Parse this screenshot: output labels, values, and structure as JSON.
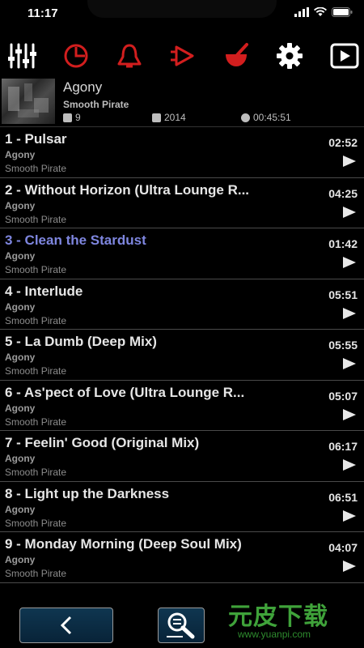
{
  "status": {
    "time": "11:17"
  },
  "toolbar": {
    "buttons": [
      {
        "name": "equalizer-icon",
        "color": "#ffffff"
      },
      {
        "name": "timer-icon",
        "color": "#d21e1e"
      },
      {
        "name": "bell-icon",
        "color": "#d21e1e"
      },
      {
        "name": "amplifier-icon",
        "color": "#d21e1e"
      },
      {
        "name": "mortar-icon",
        "color": "#d21e1e"
      },
      {
        "name": "gear-icon",
        "color": "#ffffff"
      },
      {
        "name": "play-box-icon",
        "color": "#ffffff"
      }
    ]
  },
  "album": {
    "title": "Agony",
    "artist": "Smooth Pirate",
    "track_count": "9",
    "year": "2014",
    "total_time": "00:45:51"
  },
  "tracks": [
    {
      "title": "1 - Pulsar",
      "album": "Agony",
      "artist": "Smooth Pirate",
      "duration": "02:52",
      "active": false
    },
    {
      "title": "2 - Without Horizon (Ultra Lounge R...",
      "album": "Agony",
      "artist": "Smooth Pirate",
      "duration": "04:25",
      "active": false
    },
    {
      "title": "3 - Clean the Stardust",
      "album": "Agony",
      "artist": "Smooth Pirate",
      "duration": "01:42",
      "active": true
    },
    {
      "title": "4 - Interlude",
      "album": "Agony",
      "artist": "Smooth Pirate",
      "duration": "05:51",
      "active": false
    },
    {
      "title": "5 - La Dumb (Deep Mix)",
      "album": "Agony",
      "artist": "Smooth Pirate",
      "duration": "05:55",
      "active": false
    },
    {
      "title": "6 - As'pect of Love  (Ultra Lounge R...",
      "album": "Agony",
      "artist": "Smooth Pirate",
      "duration": "05:07",
      "active": false
    },
    {
      "title": "7 - Feelin' Good  (Original Mix)",
      "album": "Agony",
      "artist": "Smooth Pirate",
      "duration": "06:17",
      "active": false
    },
    {
      "title": "8 - Light up the Darkness",
      "album": "Agony",
      "artist": "Smooth Pirate",
      "duration": "06:51",
      "active": false
    },
    {
      "title": "9 - Monday Morning (Deep Soul Mix)",
      "album": "Agony",
      "artist": "Smooth Pirate",
      "duration": "04:07",
      "active": false
    }
  ],
  "watermark": {
    "text": "元皮下载",
    "url": "www.yuanpi.com"
  },
  "colors": {
    "accent_active": "#7e86df",
    "toolbar_red": "#d21e1e",
    "button_blue": "#0f3650"
  }
}
